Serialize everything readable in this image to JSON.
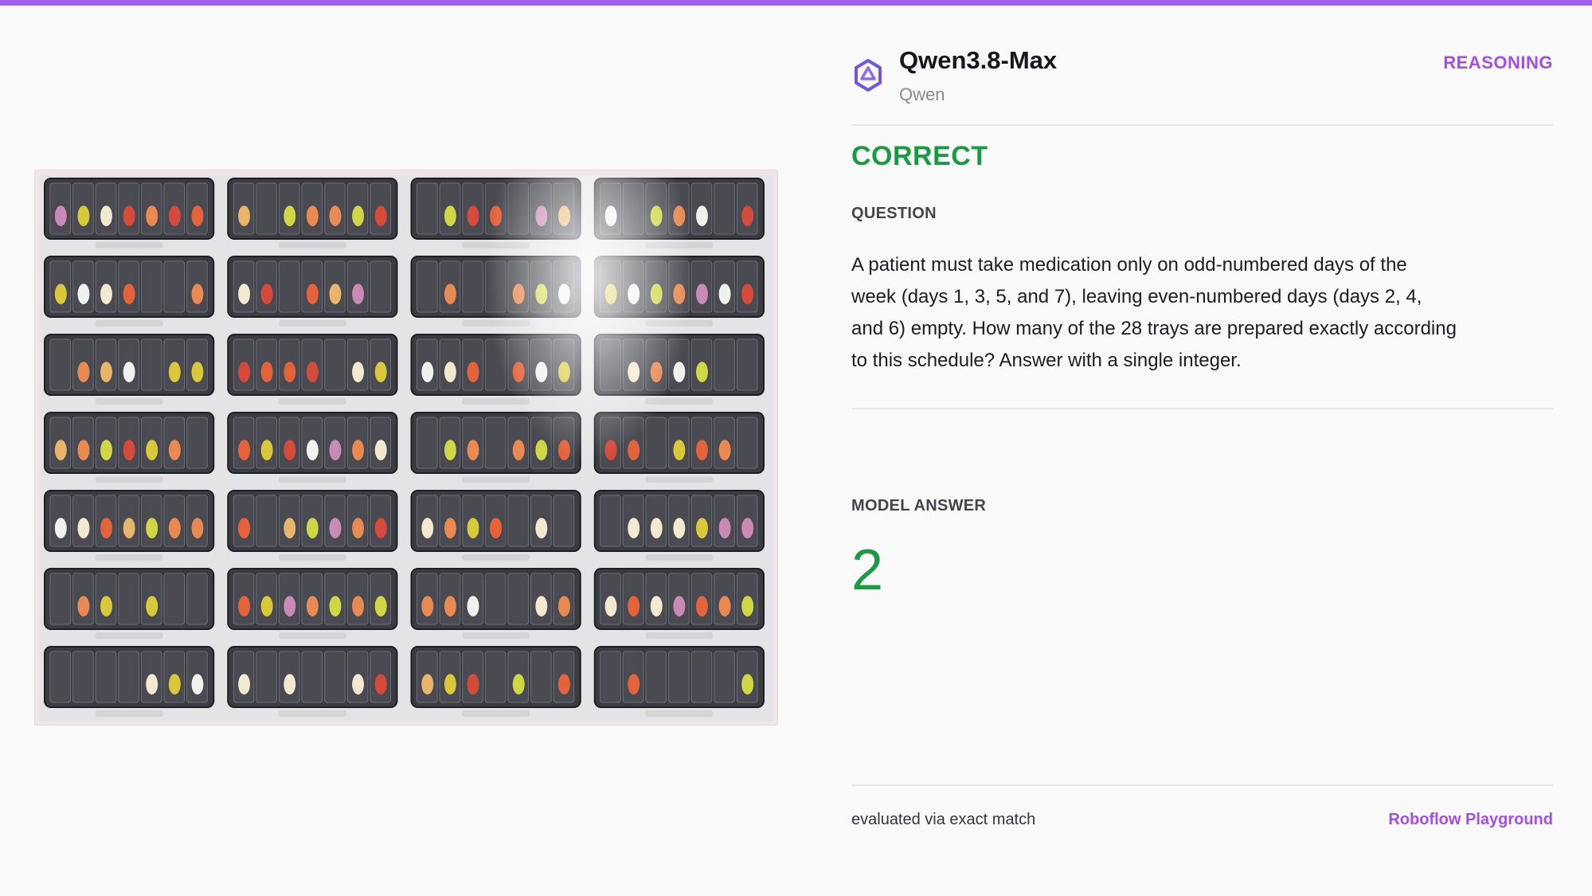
{
  "colors": {
    "accent": "#a35cf0",
    "correct": "#1b9a44",
    "tray": "#3b3c41"
  },
  "model": {
    "name": "Qwen3.8-Max",
    "provider": "Qwen",
    "mode": "REASONING",
    "icon": "qwen-logo-icon"
  },
  "result": {
    "verdict": "CORRECT"
  },
  "question": {
    "label": "QUESTION",
    "text": "A patient must take medication only on odd-numbered days of the week (days 1, 3, 5, and 7), leaving even-numbered days (days 2, 4, and 6) empty. How many of the 28 trays are prepared exactly according to this schedule? Answer with a single integer."
  },
  "answer": {
    "label": "MODEL ANSWER",
    "value": "2"
  },
  "footer": {
    "evaluation": "evaluated via exact match",
    "link": "Roboflow Playground"
  },
  "image": {
    "subject": "pill-tray-photo",
    "tray_columns": 4,
    "tray_rows": 7,
    "compartments_per_tray": 7
  }
}
